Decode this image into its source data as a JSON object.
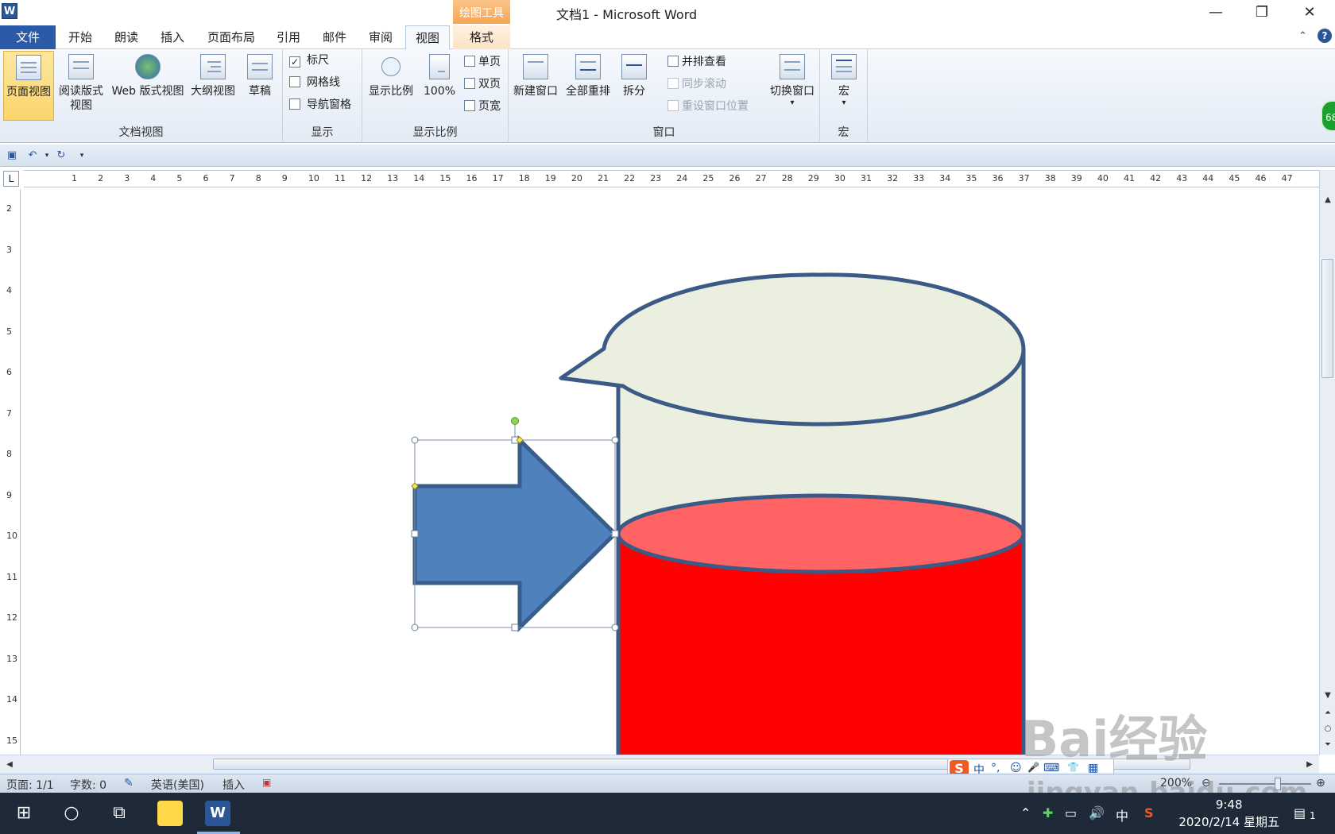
{
  "window": {
    "title": "文档1 - Microsoft Word",
    "app_icon_letter": "W",
    "minimize_glyph": "—",
    "restore_glyph": "❐",
    "close_glyph": "✕"
  },
  "context_tab_header": "绘图工具",
  "tabs": [
    {
      "label": "文件"
    },
    {
      "label": "开始"
    },
    {
      "label": "朗读"
    },
    {
      "label": "插入"
    },
    {
      "label": "页面布局"
    },
    {
      "label": "引用"
    },
    {
      "label": "邮件"
    },
    {
      "label": "审阅"
    },
    {
      "label": "视图"
    },
    {
      "label": "格式"
    }
  ],
  "active_tab": "视图",
  "ribbon": {
    "doc_views": {
      "label": "文档视图",
      "print_layout": "页面视图",
      "read_mode_line1": "阅读版式",
      "read_mode_line2": "视图",
      "web_layout": "Web 版式视图",
      "outline": "大纲视图",
      "draft": "草稿"
    },
    "show": {
      "label": "显示",
      "ruler": "标尺",
      "ruler_checked": true,
      "gridlines": "网格线",
      "gridlines_checked": false,
      "nav_pane": "导航窗格",
      "nav_pane_checked": false
    },
    "zoom": {
      "label": "显示比例",
      "zoom": "显示比例",
      "hundred": "100%",
      "one_page": "单页",
      "two_pages": "双页",
      "page_width": "页宽"
    },
    "window": {
      "label": "窗口",
      "new_window": "新建窗口",
      "arrange_all": "全部重排",
      "split": "拆分",
      "side_by_side": "并排查看",
      "sync_scroll": "同步滚动",
      "reset_position": "重设窗口位置",
      "switch_windows": "切换窗口",
      "dropdown_glyph": "▾"
    },
    "macros": {
      "label": "宏",
      "macros": "宏",
      "dropdown_glyph": "▾"
    }
  },
  "side_badge": "68",
  "ruler": {
    "corner": "L",
    "h_labels": [
      "1",
      "2",
      "3",
      "4",
      "5",
      "6",
      "7",
      "8",
      "9",
      "10",
      "11",
      "12",
      "13",
      "14",
      "15",
      "16",
      "17",
      "18",
      "19",
      "20",
      "21",
      "22",
      "23",
      "24",
      "25",
      "26",
      "27",
      "28",
      "29",
      "30",
      "31",
      "32",
      "33",
      "34",
      "35",
      "36",
      "37",
      "38",
      "39",
      "40",
      "41",
      "42",
      "43",
      "44",
      "45",
      "46",
      "47"
    ],
    "v_labels": [
      "2",
      "3",
      "4",
      "5",
      "6",
      "7",
      "8",
      "9",
      "10",
      "11",
      "12",
      "13",
      "14",
      "15"
    ]
  },
  "ime": {
    "logo": "S",
    "lang": "中",
    "punct": "°,",
    "emoji": "☺",
    "mic": "🎤",
    "keyboard": "⌨",
    "skin": "👕",
    "tools": "▦"
  },
  "status": {
    "page": "页面: 1/1",
    "words": "字数: 0",
    "language": "英语(美国)",
    "mode": "插入",
    "zoom": "200%"
  },
  "taskbar": {
    "clock_time": "9:48",
    "clock_date": "2020/2/14 星期五",
    "ime_indicator": "中",
    "notification_count": "1"
  },
  "watermark": {
    "line1": "Bai经验",
    "line2": "jingyan.baidu.com"
  },
  "colors": {
    "file_tab": "#2a5aa8",
    "context_tab": "#f7a24b",
    "beaker_fill": "#ebefe0",
    "beaker_stroke": "#3b5a85",
    "liquid": "#ff0000",
    "liquid_top": "#ff6363",
    "arrow_fill": "#4f81bd",
    "arrow_stroke": "#385d8a"
  }
}
